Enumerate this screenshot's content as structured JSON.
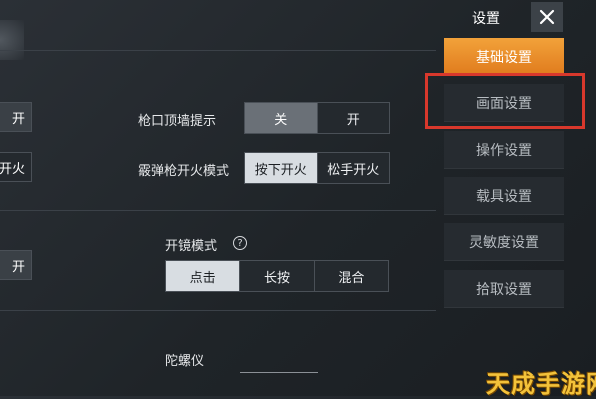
{
  "sidebar": {
    "title": "设置",
    "items": [
      {
        "label": "基础设置"
      },
      {
        "label": "画面设置"
      },
      {
        "label": "操作设置"
      },
      {
        "label": "载具设置"
      },
      {
        "label": "灵敏度设置"
      },
      {
        "label": "拾取设置"
      }
    ]
  },
  "settings": {
    "muzzle_hint": {
      "label": "枪口顶墙提示",
      "options": [
        "关",
        "开"
      ],
      "selected": "关"
    },
    "shotgun_fire": {
      "label": "霰弹枪开火模式",
      "options": [
        "按下开火",
        "松手开火"
      ],
      "selected": "按下开火"
    },
    "scope_mode": {
      "label": "开镜模式",
      "options": [
        "点击",
        "长按",
        "混合"
      ],
      "selected": "点击"
    },
    "gyroscope": {
      "label": "陀螺仪"
    }
  },
  "left_partial": {
    "row1": "开",
    "row2": "开火",
    "row3": "开"
  },
  "watermark": "天成手游网",
  "colors": {
    "accent": "#e98a25",
    "highlight_box": "#d8382c"
  }
}
